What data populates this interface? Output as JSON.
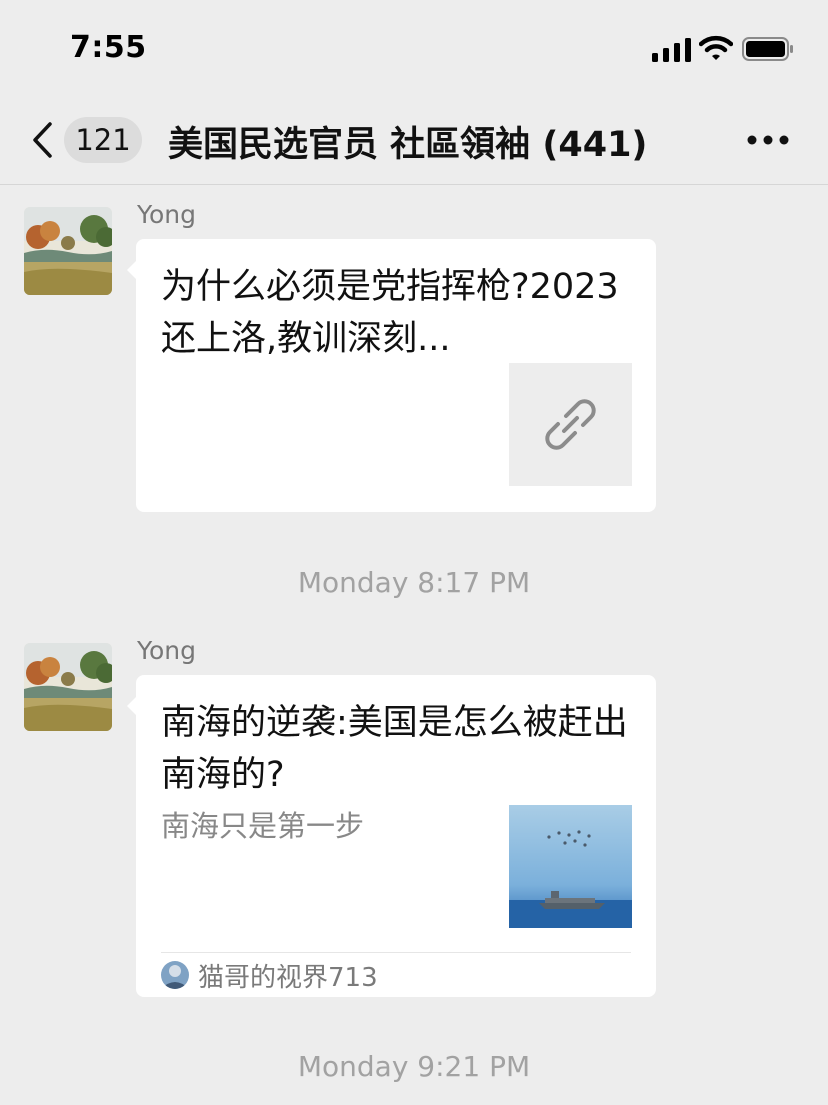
{
  "status": {
    "time": "7:55"
  },
  "nav": {
    "back_count": "121",
    "title": "美国民选官员 社區領袖 (441)"
  },
  "messages": [
    {
      "sender": "Yong",
      "title": "为什么必须是党指挥枪?2023还上洛,教训深刻...",
      "thumb_icon": "link-icon"
    },
    {
      "sender": "Yong",
      "title": "南海的逆袭:美国是怎么被赶出南海的?",
      "desc": "南海只是第一步",
      "source": "猫哥的视界713",
      "thumb_icon": "aircraft-carrier-photo"
    }
  ],
  "timestamps": [
    "Monday 8:17 PM",
    "Monday 9:21 PM"
  ],
  "colors": {
    "background": "#ededed",
    "bubble": "#ffffff",
    "pill": "#dcdcdc"
  }
}
